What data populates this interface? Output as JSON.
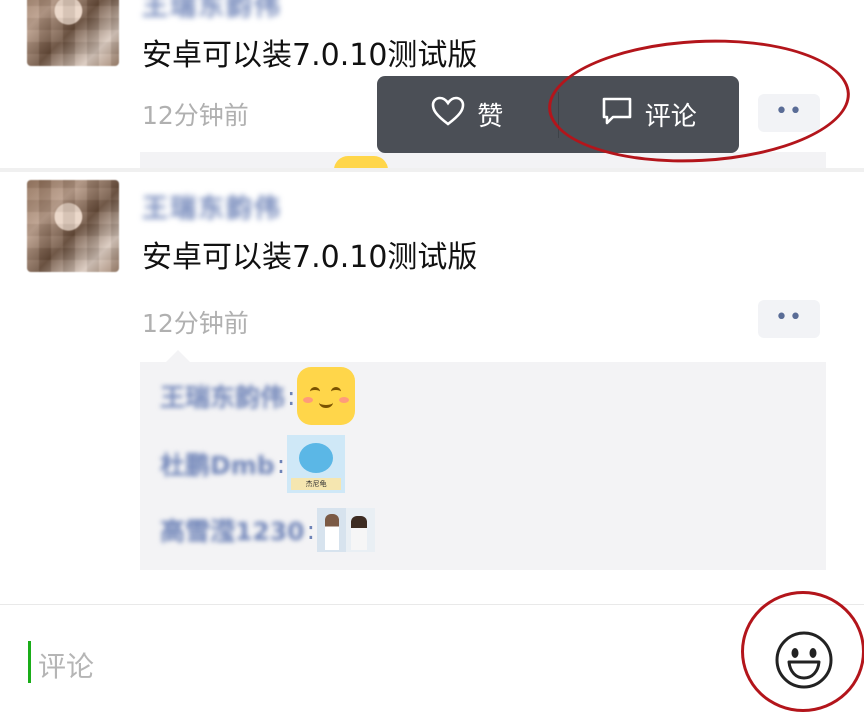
{
  "posts": [
    {
      "username": "王瑞东韵伟",
      "text": "安卓可以装7.0.10测试版",
      "time": "12分钟前",
      "more_label": "••"
    },
    {
      "username": "王瑞东韵伟",
      "text": "安卓可以装7.0.10测试版",
      "time": "12分钟前",
      "more_label": "••",
      "comments": [
        {
          "author": "王瑞东韵伟",
          "sticker": "smile-sticker"
        },
        {
          "author": "杜鹏Dmb",
          "sticker": "squirtle-sticker"
        },
        {
          "author": "高雪滢1230",
          "sticker": "photo-sticker"
        }
      ]
    }
  ],
  "action_popup": {
    "like_label": "赞",
    "comment_label": "评论"
  },
  "input_bar": {
    "placeholder": "评论"
  },
  "sticker_text": {
    "squirtle": "杰尼龟"
  },
  "colors": {
    "username_blue": "#6f84b8",
    "popup_bg": "#4b4f56",
    "annotation_red": "#b3151b",
    "cursor_green": "#1aad19"
  },
  "icons": [
    "heart-icon",
    "comment-bubble-icon",
    "emoji-icon"
  ]
}
